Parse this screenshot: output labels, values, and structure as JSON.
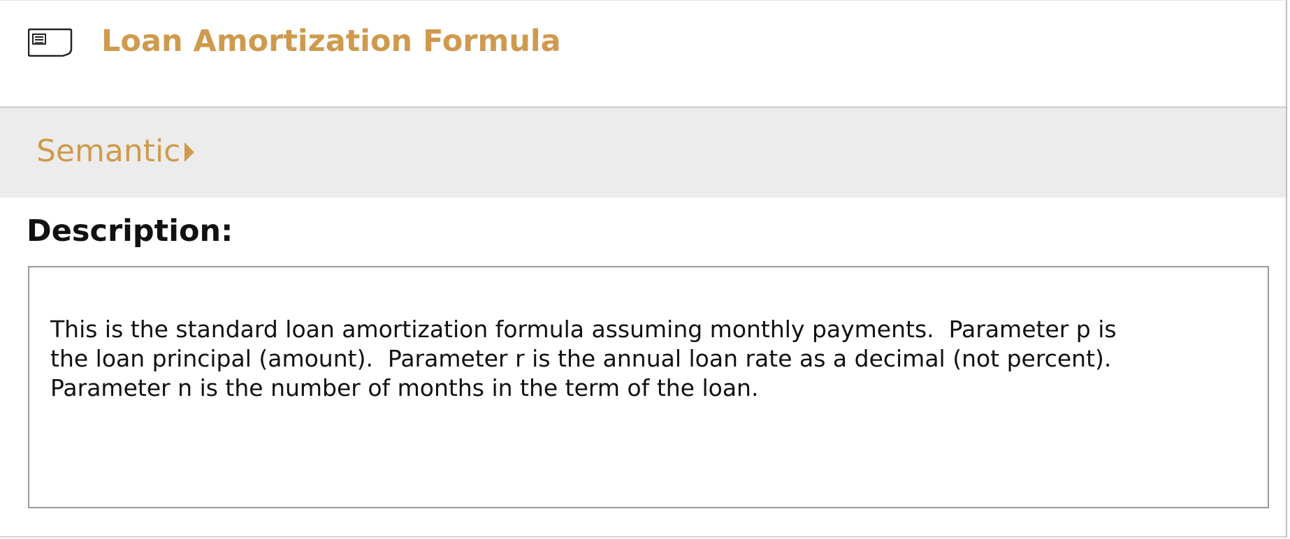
{
  "header": {
    "icon": "card-icon",
    "title": "Loan Amortization Formula"
  },
  "section_tab": {
    "label": "Semantic",
    "icon": "triangle-right-icon"
  },
  "description": {
    "label": "Description:",
    "text": "This is the standard loan amortization formula assuming monthly payments.  Parameter p is\nthe loan principal (amount).  Parameter r is the annual loan rate as a decimal (not percent).\nParameter n is the number of months in the term of the loan."
  },
  "colors": {
    "accent": "#cf9a4e",
    "section_bar": "#ececec",
    "text": "#111111",
    "box_border": "#9a9a9a"
  }
}
